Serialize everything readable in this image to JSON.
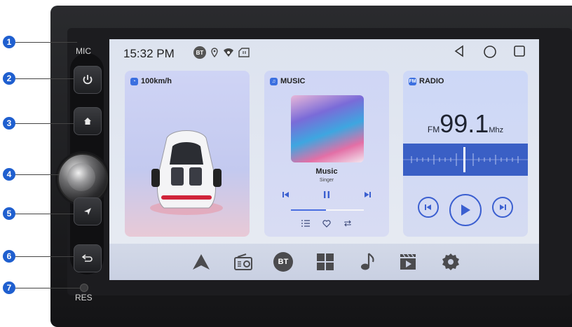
{
  "device": {
    "mic_label": "MIC",
    "res_label": "RES",
    "callouts": [
      "1",
      "2",
      "3",
      "4",
      "5",
      "6",
      "7"
    ]
  },
  "status_bar": {
    "time": "15:32 PM",
    "bt_label": "BT"
  },
  "cards": {
    "speed": {
      "title": "100km/h"
    },
    "music": {
      "title": "MUSIC",
      "song": "Music",
      "singer": "Singer",
      "progress": 0.48
    },
    "radio": {
      "title": "RADIO",
      "band_badge": "FM",
      "band": "FM",
      "frequency": "99.1",
      "unit": "Mhz"
    }
  },
  "dock": {
    "items": [
      "navigation-icon",
      "radio-icon",
      "bluetooth-icon",
      "apps-grid-icon",
      "music-note-icon",
      "video-icon",
      "settings-icon"
    ],
    "bt_label": "BT"
  },
  "colors": {
    "accent": "#3b5fd0",
    "callout": "#1f5fcf"
  }
}
